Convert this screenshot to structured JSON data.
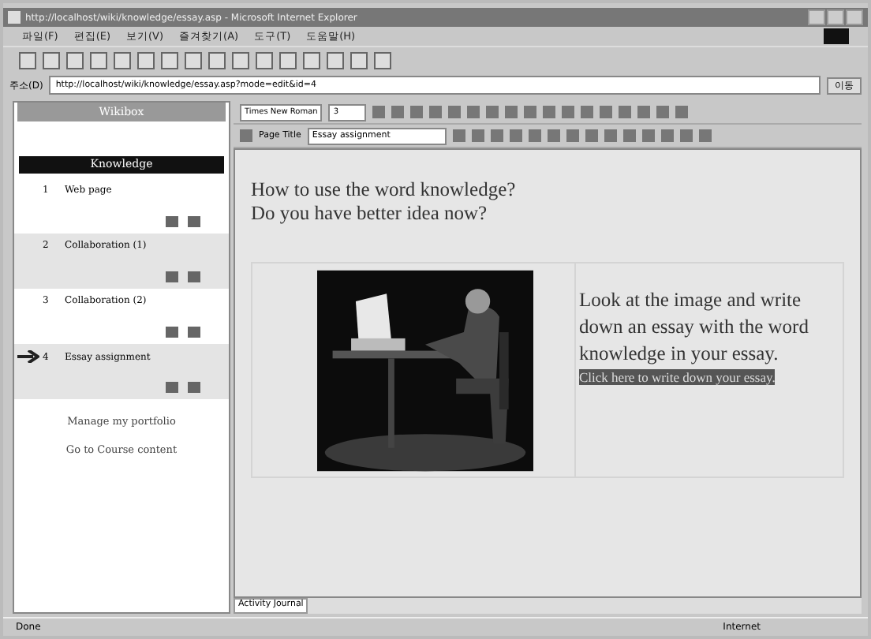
{
  "window": {
    "title": "http://localhost/wiki/knowledge/essay.asp - Microsoft Internet Explorer"
  },
  "menu": [
    "파일(F)",
    "편집(E)",
    "보기(V)",
    "즐겨찾기(A)",
    "도구(T)",
    "도움말(H)"
  ],
  "address": {
    "label": "주소(D)",
    "value": "http://localhost/wiki/knowledge/essay.asp?mode=edit&id=4",
    "go": "이동"
  },
  "sidebar": {
    "header": "Wikibox",
    "section": "Knowledge",
    "items": [
      {
        "number": "1",
        "title": "Web page",
        "current": false
      },
      {
        "number": "2",
        "title": "Collaboration (1)",
        "current": false
      },
      {
        "number": "3",
        "title": "Collaboration (2)",
        "current": false
      },
      {
        "number": "4",
        "title": "Essay assignment",
        "current": true
      }
    ],
    "links": [
      "Manage my portfolio",
      "Go to Course content"
    ]
  },
  "editor": {
    "font": "Times New Roman",
    "size": "3",
    "page_title_label": "Page Title",
    "page_title": "Essay assignment"
  },
  "content": {
    "question": [
      "How to use the word knowledge?",
      "Do you have better idea now?"
    ],
    "instruction": "Look at the image and write down an essay with the word knowledge in your essay.",
    "link": "Click here to write down your essay."
  },
  "tab": "Activity Journal",
  "status": {
    "left": "Done",
    "right": "Internet"
  }
}
